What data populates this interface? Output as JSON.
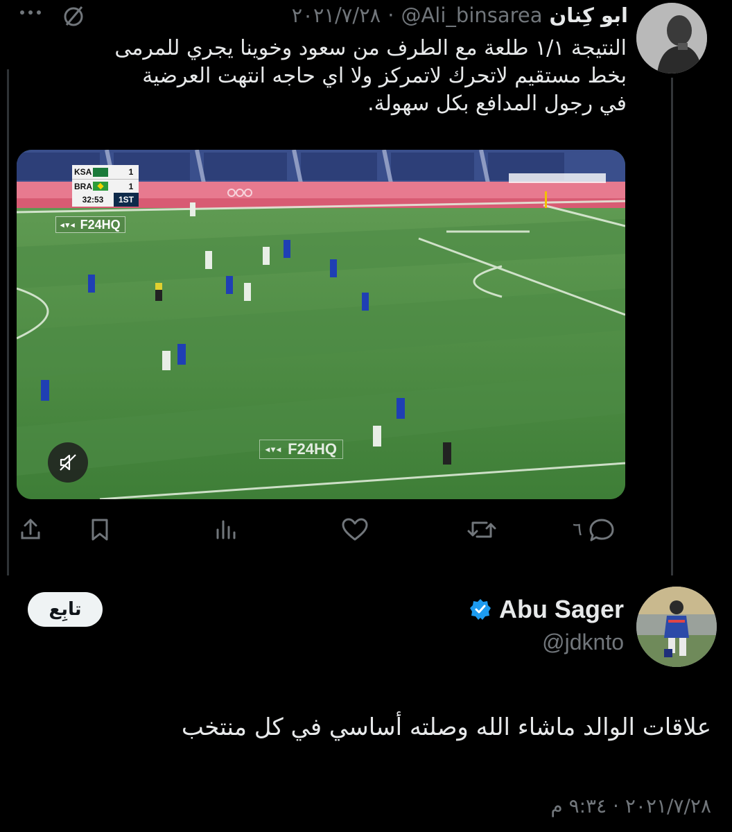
{
  "tweet": {
    "author_name": "ابو كِنان",
    "handle": "@Ali_binsarea",
    "separator": "·",
    "date": "٢٠٢١/٧/٢٨",
    "text_line1": "النتيجة ١/١ طلعة مع الطرف من سعود وخوينا يجري للمرمى",
    "text_line2": "بخط مستقيم لاتحرك لاتمركز ولا اي حاجه انتهت العرضية",
    "text_line3": "في رجول المدافع بكل سهولة.",
    "video": {
      "score_team1": "KSA",
      "score_team1_goals": "1",
      "score_team2": "BRA",
      "score_team2_goals": "1",
      "clock": "32:53",
      "period": "1ST",
      "watermark": "F24HQ",
      "muted": true
    },
    "reply_count": "٦"
  },
  "reply": {
    "author_name": "Abu Sager",
    "verified": true,
    "handle": "@jdknto",
    "follow_label": "تابِع",
    "text": "علاقات الوالد ماشاء الله وصلته أساسي في كل منتخب",
    "date": "٢٠٢١/٧/٢٨",
    "separator": "·",
    "time": "٩:٣٤ م"
  },
  "colors": {
    "background": "#000000",
    "text": "#e7e9ea",
    "secondary": "#71767b",
    "verified": "#1d9bf0",
    "follow_bg": "#eff3f4"
  }
}
